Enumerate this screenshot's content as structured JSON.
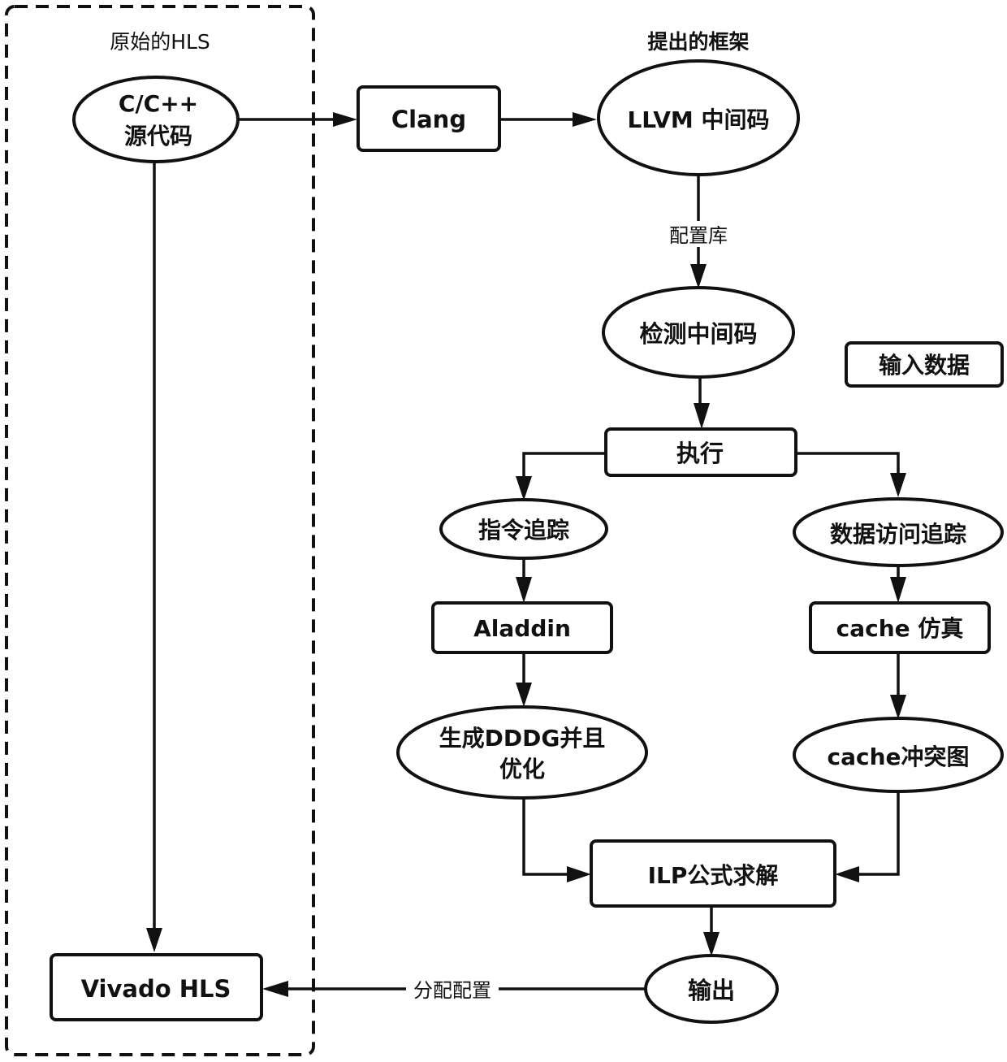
{
  "groups": {
    "original": {
      "title": "原始的HLS"
    },
    "proposed": {
      "title": "提出的框架"
    }
  },
  "nodes": {
    "source": {
      "lines": [
        "C/C++",
        "源代码"
      ],
      "shape": "ellipse"
    },
    "clang": {
      "lines": [
        "Clang"
      ],
      "shape": "rect"
    },
    "llvm": {
      "lines": [
        "LLVM 中间码"
      ],
      "shape": "ellipse"
    },
    "instrumented": {
      "lines": [
        "检测中间码"
      ],
      "shape": "ellipse"
    },
    "input_data": {
      "lines": [
        "输入数据"
      ],
      "shape": "rect"
    },
    "execute": {
      "lines": [
        "执行"
      ],
      "shape": "rect"
    },
    "inst_trace": {
      "lines": [
        "指令追踪"
      ],
      "shape": "ellipse"
    },
    "data_trace": {
      "lines": [
        "数据访问追踪"
      ],
      "shape": "ellipse"
    },
    "aladdin": {
      "lines": [
        "Aladdin"
      ],
      "shape": "rect"
    },
    "cache_sim": {
      "lines": [
        "cache 仿真"
      ],
      "shape": "rect"
    },
    "dddg": {
      "lines": [
        "生成DDDG并且",
        "优化"
      ],
      "shape": "ellipse"
    },
    "conflict": {
      "lines": [
        "cache冲突图"
      ],
      "shape": "ellipse"
    },
    "ilp": {
      "lines": [
        "ILP公式求解"
      ],
      "shape": "rect"
    },
    "output": {
      "lines": [
        "输出"
      ],
      "shape": "ellipse"
    },
    "vivado": {
      "lines": [
        "Vivado HLS"
      ],
      "shape": "rect"
    }
  },
  "edge_labels": {
    "config_lib": "配置库",
    "assign_config": "分配配置"
  },
  "edges": [
    {
      "from": "source",
      "to": "clang"
    },
    {
      "from": "clang",
      "to": "llvm"
    },
    {
      "from": "llvm",
      "to": "instrumented",
      "label": "配置库"
    },
    {
      "from": "instrumented",
      "to": "execute"
    },
    {
      "from": "execute",
      "to": "inst_trace"
    },
    {
      "from": "execute",
      "to": "data_trace"
    },
    {
      "from": "inst_trace",
      "to": "aladdin"
    },
    {
      "from": "data_trace",
      "to": "cache_sim"
    },
    {
      "from": "aladdin",
      "to": "dddg"
    },
    {
      "from": "cache_sim",
      "to": "conflict"
    },
    {
      "from": "dddg",
      "to": "ilp"
    },
    {
      "from": "conflict",
      "to": "ilp"
    },
    {
      "from": "ilp",
      "to": "output"
    },
    {
      "from": "output",
      "to": "vivado",
      "label": "分配配置"
    },
    {
      "from": "source",
      "to": "vivado"
    }
  ]
}
